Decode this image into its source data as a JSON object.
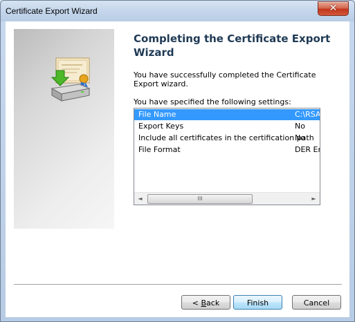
{
  "window": {
    "title": "Certificate Export Wizard",
    "close_glyph": "✕"
  },
  "side_panel": {
    "graphic": "certificate-export-icon"
  },
  "content": {
    "heading": "Completing the Certificate Export Wizard",
    "intro": "You have successfully completed the Certificate Export wizard.",
    "settings_label": "You have specified the following settings:"
  },
  "settings": [
    {
      "key": "File Name",
      "value": "C:\\RSA",
      "selected": true
    },
    {
      "key": "Export Keys",
      "value": "No"
    },
    {
      "key": "Include all certificates in the certification path",
      "value": "No"
    },
    {
      "key": "File Format",
      "value": "DER En"
    }
  ],
  "scrollbar": {
    "left_arrow": "◄",
    "right_arrow": "►",
    "thumb_grip": "III"
  },
  "buttons": {
    "back_prefix": "< ",
    "back_mnemonic": "B",
    "back_rest": "ack",
    "finish": "Finish",
    "cancel": "Cancel"
  },
  "colors": {
    "selection": "#3399ff",
    "heading": "#1f3a55",
    "close": "#c0361b"
  }
}
